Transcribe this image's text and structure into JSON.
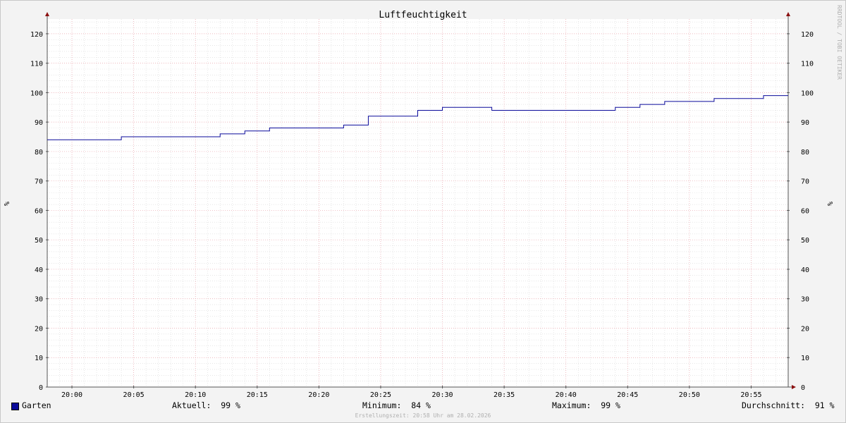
{
  "chart_data": {
    "type": "line",
    "title": "Luftfeuchtigkeit",
    "ylabel_left": "%",
    "ylabel_right": "%",
    "ylim": [
      0,
      125
    ],
    "yticks": [
      0,
      10,
      20,
      30,
      40,
      50,
      60,
      70,
      80,
      90,
      100,
      110,
      120
    ],
    "xlim": [
      "19:58",
      "20:58"
    ],
    "xticks": [
      "20:00",
      "20:05",
      "20:10",
      "20:15",
      "20:20",
      "20:25",
      "20:30",
      "20:35",
      "20:40",
      "20:45",
      "20:50",
      "20:55"
    ],
    "grid": true,
    "line_style": "step",
    "series": [
      {
        "name": "Garten",
        "color": "#0a0a9a",
        "points": [
          {
            "x": "19:58",
            "y": 84
          },
          {
            "x": "20:04",
            "y": 85
          },
          {
            "x": "20:12",
            "y": 86
          },
          {
            "x": "20:14",
            "y": 87
          },
          {
            "x": "20:16",
            "y": 88
          },
          {
            "x": "20:22",
            "y": 89
          },
          {
            "x": "20:24",
            "y": 92
          },
          {
            "x": "20:28",
            "y": 94
          },
          {
            "x": "20:30",
            "y": 95
          },
          {
            "x": "20:34",
            "y": 94
          },
          {
            "x": "20:44",
            "y": 95
          },
          {
            "x": "20:46",
            "y": 96
          },
          {
            "x": "20:48",
            "y": 97
          },
          {
            "x": "20:52",
            "y": 98
          },
          {
            "x": "20:56",
            "y": 99
          },
          {
            "x": "20:58",
            "y": 99
          }
        ]
      }
    ]
  },
  "legend": {
    "series_name": "Garten",
    "aktuell": "Aktuell:  99 %",
    "minimum": "Minimum:  84 %",
    "maximum": "Maximum:  99 %",
    "durchschnitt": "Durchschnitt:  91 %"
  },
  "footer": "Erstellungszeit: 20:58 Uhr am 28.02.2026",
  "watermark": "RRDTOOL / TOBI OETIKER",
  "colors": {
    "background": "#f3f3f3",
    "plot_background": "#ffffff",
    "major_grid": "#e8a0a8",
    "minor_grid": "#d8d8d8",
    "axis": "#555555",
    "arrow": "#8b1010",
    "line": "#0a0a9a"
  }
}
